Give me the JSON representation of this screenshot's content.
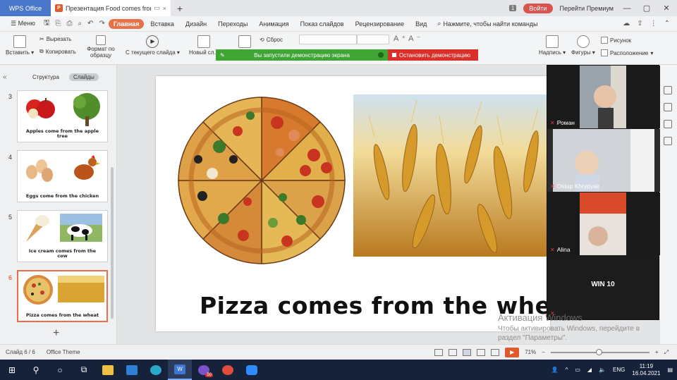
{
  "titlebar": {
    "app_tab": "WPS Office",
    "doc_tab": "Презентация Food comes from",
    "window_badge": "1",
    "login": "Войти",
    "premium": "Перейти Премиум"
  },
  "menu": {
    "main_menu": "Меню",
    "tabs": [
      "Главная",
      "Вставка",
      "Дизайн",
      "Переходы",
      "Анимация",
      "Показ слайдов",
      "Рецензирование",
      "Вид"
    ],
    "search_command": "Нажмите, чтобы найти команды"
  },
  "ribbon": {
    "paste": "Вставить",
    "cut": "Вырезать",
    "copy": "Копировать",
    "format_painter": "Формат по образцу",
    "from_current": "С текущего слайда",
    "new_slide": "Новый сл...",
    "reset": "Сброс",
    "textbox": "Надпись",
    "shapes": "Фигуры",
    "picture": "Рисунок",
    "arrange": "Расположение"
  },
  "demo_bar": {
    "message": "Вы запустили демонстрацию экрана",
    "stop": "Остановить демонстрацию"
  },
  "leftpane": {
    "tab_outline": "Структура",
    "tab_slides": "Слайды",
    "thumbnails": [
      {
        "num": "3",
        "caption": "Apples come from the apple tree"
      },
      {
        "num": "4",
        "caption": "Eggs come from the chicken"
      },
      {
        "num": "5",
        "caption": "Ice cream comes from the cow"
      },
      {
        "num": "6",
        "caption": "Pizza comes from the wheat"
      }
    ]
  },
  "slide": {
    "title": "Pizza comes from the wheat"
  },
  "video": {
    "participants": [
      "Роман",
      "Ostap Khrypyak",
      "Alina"
    ],
    "bottom_label": "WIN 10"
  },
  "activate": {
    "line1": "Активация Windows",
    "line2": "Чтобы активировать Windows, перейдите в",
    "line3": "раздел \"Параметры\"."
  },
  "statusbar": {
    "slide_counter": "Слайд 6 / 6",
    "theme": "Office Theme",
    "zoom": "71%"
  },
  "taskbar": {
    "lang": "ENG",
    "time": "11:19",
    "date": "16.04.2021",
    "viber_badge": "50"
  },
  "colors": {
    "accent": "#e7724a",
    "app_tab": "#4a77c9",
    "demo_green": "#3fa535",
    "demo_red": "#d9302a"
  }
}
